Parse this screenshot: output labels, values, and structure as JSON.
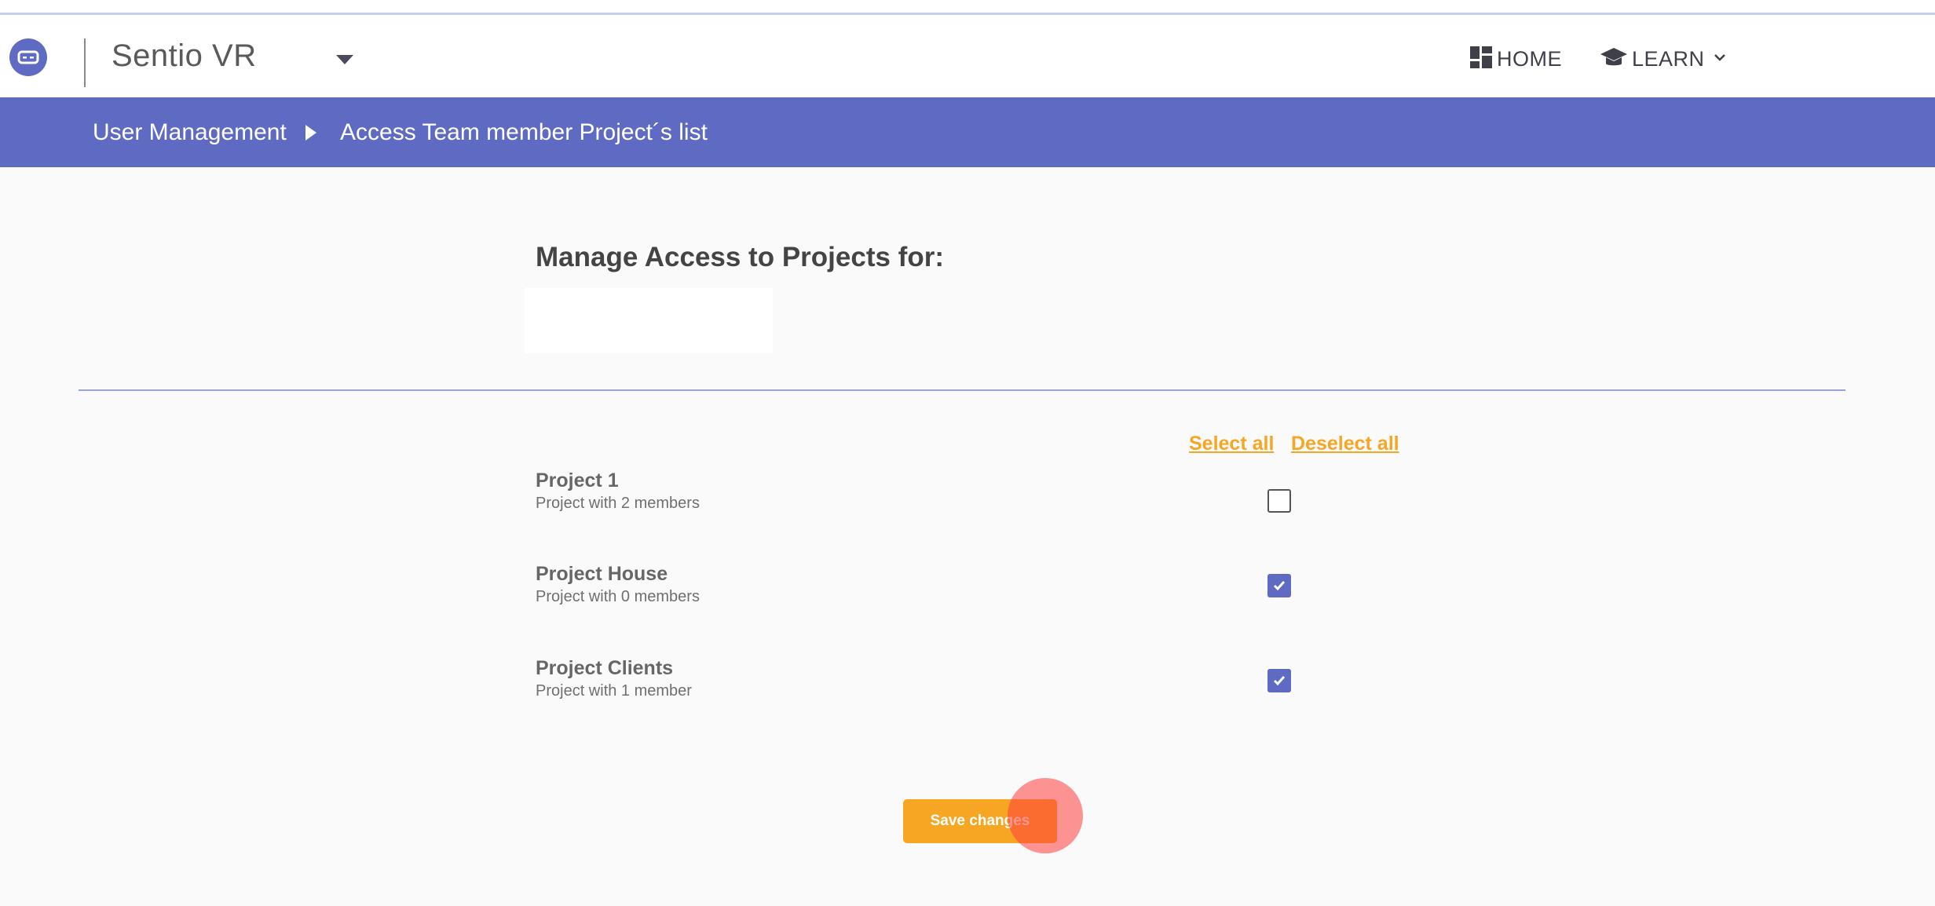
{
  "header": {
    "app_title": "Sentio VR",
    "nav": {
      "home_label": "HOME",
      "learn_label": "LEARN"
    }
  },
  "breadcrumb": {
    "items": [
      "User Management",
      "Access Team member Project´s list"
    ]
  },
  "main": {
    "heading": "Manage Access to Projects for:",
    "select_all_label": "Select all",
    "deselect_all_label": "Deselect all",
    "projects": [
      {
        "name": "Project 1",
        "description": "Project with 2 members",
        "checked": false
      },
      {
        "name": "Project House",
        "description": "Project with 0 members",
        "checked": true
      },
      {
        "name": "Project Clients",
        "description": "Project with 1 member",
        "checked": true
      }
    ],
    "save_label": "Save changes"
  },
  "colors": {
    "primary": "#5f6bc3",
    "accent": "#f6a623",
    "click_marker": "#ff3c3c"
  },
  "icons": {
    "logo": "vr-headset-icon",
    "home": "dashboard-icon",
    "learn": "graduation-cap-icon",
    "dropdown": "caret-down-icon",
    "learn_dropdown": "chevron-down-icon",
    "breadcrumb_separator": "play-arrow-icon",
    "checkbox": "check-icon"
  }
}
